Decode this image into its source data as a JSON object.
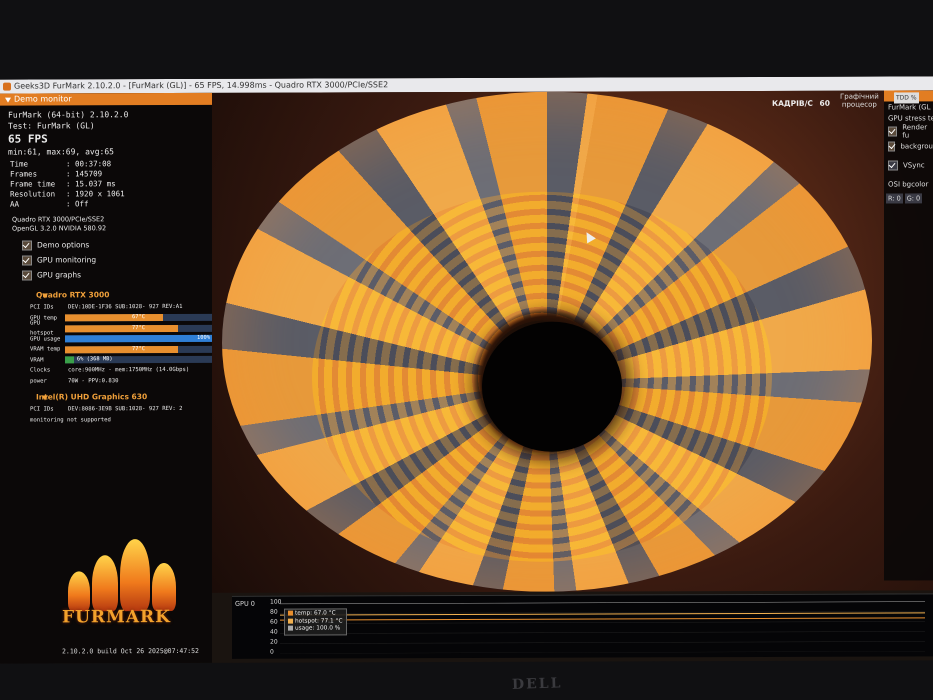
{
  "window": {
    "title": "Geeks3D FurMark 2.10.2.0 - [FurMark (GL)] - 65 FPS, 14.998ms - Quadro RTX 3000/PCIe/SSE2"
  },
  "demo_monitor": {
    "header": "Demo monitor",
    "app_line": "FurMark (64-bit) 2.10.2.0",
    "test_line": "Test: FurMark (GL)",
    "fps": "65 FPS",
    "fps_stats": "min:61, max:69, avg:65",
    "stats": [
      {
        "k": "Time",
        "v": ": 00:37:08"
      },
      {
        "k": "Frames",
        "v": ": 145709"
      },
      {
        "k": "Frame time",
        "v": ": 15.037 ms"
      },
      {
        "k": "Resolution",
        "v": ": 1920 x 1061"
      },
      {
        "k": "AA",
        "v": ": Off"
      }
    ],
    "gpu_name": "Quadro RTX 3000/PCIe/SSE2",
    "opengl": "OpenGL 3.2.0 NVIDIA 580.92",
    "options": {
      "demo_options": "Demo options",
      "gpu_monitoring": "GPU monitoring",
      "gpu_graphs": "GPU graphs"
    }
  },
  "gpu0": {
    "header": "Quadro RTX 3000",
    "pci_label": "PCI IDs",
    "pci_value": "DEV:10DE-1F36 SUB:1028- 927 REV:A1",
    "temp_label": "GPU temp",
    "temp_value": "67°C",
    "temp_fraction": 0.67,
    "hotspot_label": "GPU hotspot",
    "hotspot_value": "77°C",
    "hotspot_fraction": 0.77,
    "usage_label": "GPU usage",
    "usage_value": "100%",
    "usage_fraction": 1.0,
    "vram_temp_label": "VRAM temp",
    "vram_temp_value": "77°C",
    "vram_temp_fraction": 0.77,
    "vram_label": "VRAM",
    "vram_value": "6% (368 MB)",
    "vram_fraction": 0.06,
    "clocks_label": "Clocks",
    "clocks_value": "core:900MHz - mem:1750MHz (14.0Gbps)",
    "power_label": "power",
    "power_value": "70W - PPV:0.830"
  },
  "gpu1": {
    "header": "Intel(R) UHD Graphics 630",
    "pci_label": "PCI IDs",
    "pci_value": "DEV:8086-3E9B SUB:1028- 927 REV: 2",
    "note": "monitoring not supported"
  },
  "logo": {
    "text": "FURMARK",
    "build": "2.10.2.0 build Oct 26 2025@07:47:52"
  },
  "render_hud": {
    "fps_label": "КАДРІВ/С",
    "fps_value": "60",
    "proc_line1": "Графічний",
    "proc_line2": "процесор"
  },
  "right_panel": {
    "header": "D",
    "tab": "TDD %",
    "app": "FurMark (GL",
    "desc": "GPU stress te",
    "render_fur": "Render fu",
    "background": "backgrou",
    "vsync": "VSync",
    "bgcolor": "OSI bgcolor",
    "r": "R: 0",
    "g": "G: 0"
  },
  "graph": {
    "label": "GPU 0",
    "ticks": [
      "100",
      "80",
      "60",
      "40",
      "20",
      "0"
    ],
    "legend": [
      {
        "name": "temp: 67.0 °C",
        "color": "#e88f2e"
      },
      {
        "name": "hotspot: 77.1 °C",
        "color": "#f0b050"
      },
      {
        "name": "usage: 100.0 %",
        "color": "#aaaaaa"
      }
    ]
  },
  "chart_data": {
    "type": "line",
    "ylim": [
      0,
      100
    ],
    "series": [
      {
        "name": "temp: 67.0 °C",
        "values": [
          67,
          67,
          67,
          67,
          67,
          67,
          67,
          67,
          67,
          67
        ]
      },
      {
        "name": "hotspot: 77.1 °C",
        "values": [
          77,
          77,
          77,
          77,
          77,
          77,
          77,
          77,
          77,
          77
        ]
      },
      {
        "name": "usage: 100.0 %",
        "values": [
          100,
          100,
          100,
          100,
          100,
          100,
          100,
          100,
          100,
          100
        ]
      }
    ]
  },
  "bezel": {
    "brand": "DELL"
  }
}
